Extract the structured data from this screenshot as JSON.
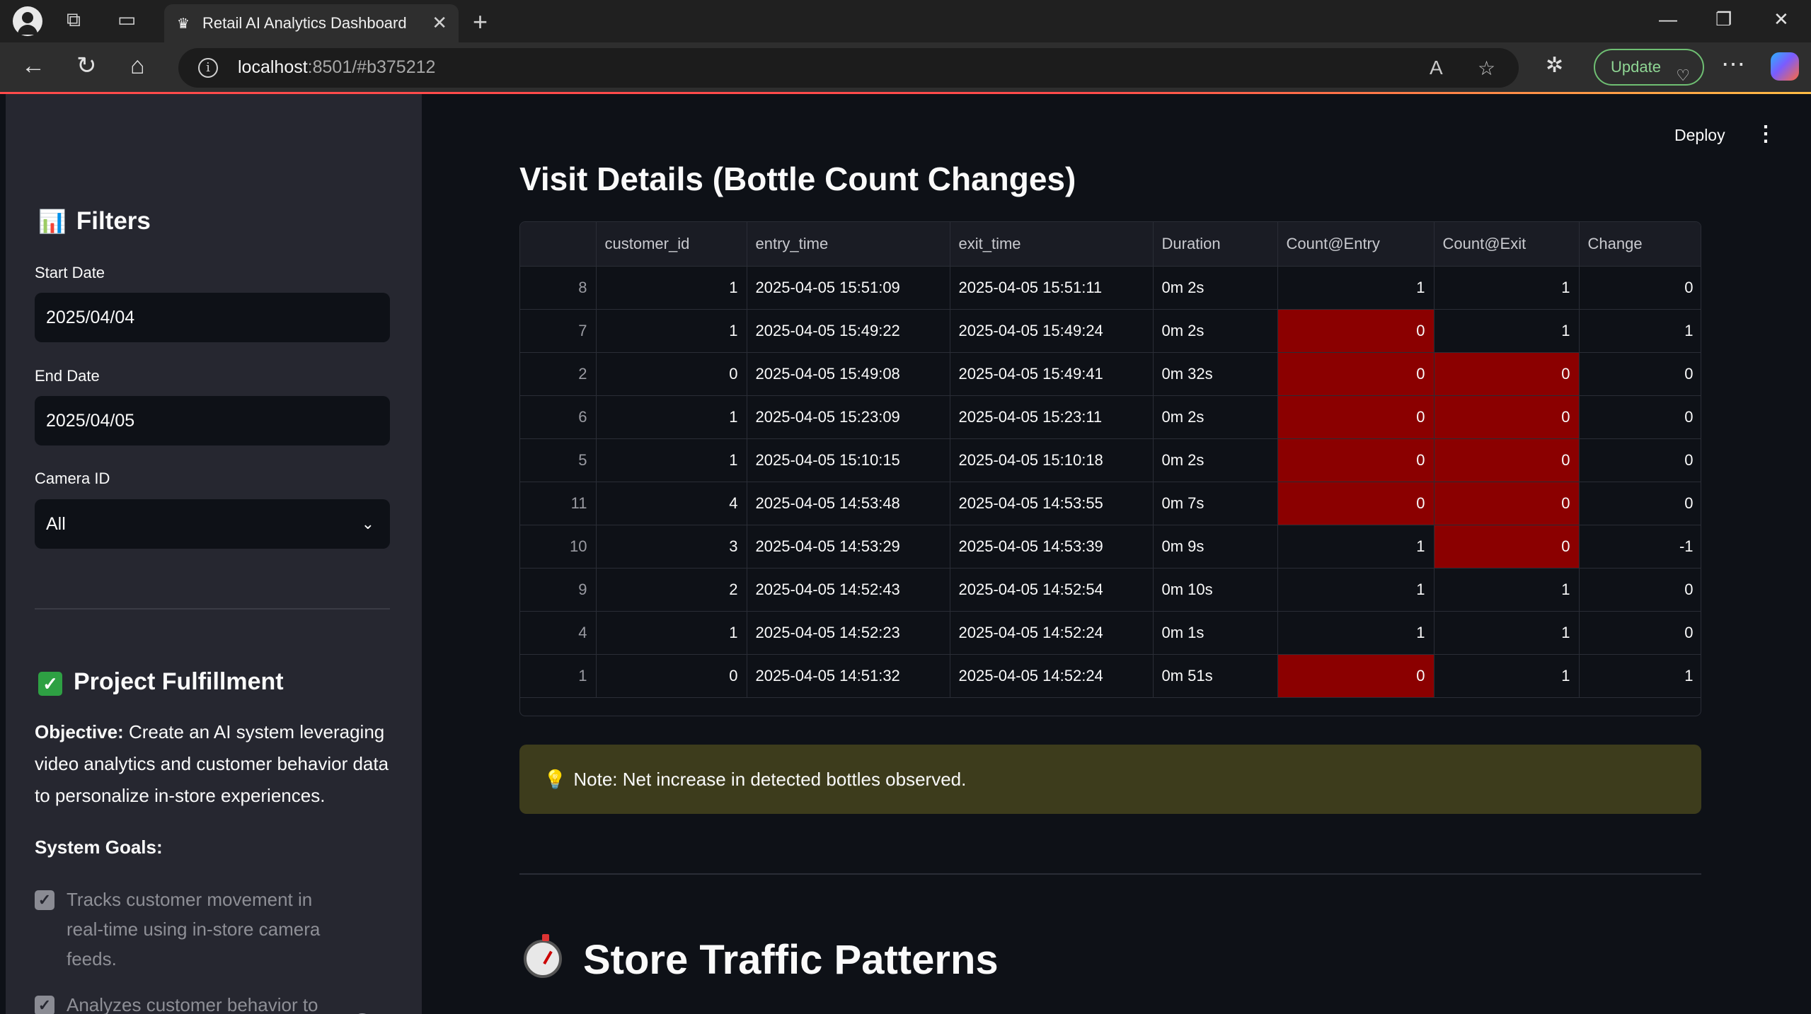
{
  "browser": {
    "tab_title": "Retail AI Analytics Dashboard",
    "url_host": "localhost",
    "url_rest": ":8501/#b375212",
    "update_label": "Update"
  },
  "header": {
    "deploy_label": "Deploy"
  },
  "sidebar": {
    "filters_title": "Filters",
    "start_date_label": "Start Date",
    "start_date_value": "2025/04/04",
    "end_date_label": "End Date",
    "end_date_value": "2025/04/05",
    "camera_label": "Camera ID",
    "camera_value": "All",
    "project_title": "Project Fulfillment",
    "objective_label": "Objective:",
    "objective_text": " Create an AI system leveraging video analytics and customer behavior data to personalize in-store experiences.",
    "goals_title": "System Goals:",
    "goal_1": "Tracks customer movement in real-time using in-store camera feeds.",
    "goal_2": "Analyzes customer behavior to"
  },
  "main": {
    "title": "Visit Details (Bottle Count Changes)",
    "note_text": "Note: Net increase in detected bottles observed.",
    "section_title": "Store Traffic Patterns"
  },
  "table": {
    "columns": [
      "",
      "customer_id",
      "entry_time",
      "exit_time",
      "Duration",
      "Count@Entry",
      "Count@Exit",
      "Change"
    ],
    "rows": [
      {
        "idx": "8",
        "customer_id": "1",
        "entry_time": "2025-04-05 15:51:09",
        "exit_time": "2025-04-05 15:51:11",
        "duration": "0m 2s",
        "count_entry": "1",
        "count_exit": "1",
        "change": "0",
        "entry_red": false,
        "exit_red": false
      },
      {
        "idx": "7",
        "customer_id": "1",
        "entry_time": "2025-04-05 15:49:22",
        "exit_time": "2025-04-05 15:49:24",
        "duration": "0m 2s",
        "count_entry": "0",
        "count_exit": "1",
        "change": "1",
        "entry_red": true,
        "exit_red": false
      },
      {
        "idx": "2",
        "customer_id": "0",
        "entry_time": "2025-04-05 15:49:08",
        "exit_time": "2025-04-05 15:49:41",
        "duration": "0m 32s",
        "count_entry": "0",
        "count_exit": "0",
        "change": "0",
        "entry_red": true,
        "exit_red": true
      },
      {
        "idx": "6",
        "customer_id": "1",
        "entry_time": "2025-04-05 15:23:09",
        "exit_time": "2025-04-05 15:23:11",
        "duration": "0m 2s",
        "count_entry": "0",
        "count_exit": "0",
        "change": "0",
        "entry_red": true,
        "exit_red": true
      },
      {
        "idx": "5",
        "customer_id": "1",
        "entry_time": "2025-04-05 15:10:15",
        "exit_time": "2025-04-05 15:10:18",
        "duration": "0m 2s",
        "count_entry": "0",
        "count_exit": "0",
        "change": "0",
        "entry_red": true,
        "exit_red": true
      },
      {
        "idx": "11",
        "customer_id": "4",
        "entry_time": "2025-04-05 14:53:48",
        "exit_time": "2025-04-05 14:53:55",
        "duration": "0m 7s",
        "count_entry": "0",
        "count_exit": "0",
        "change": "0",
        "entry_red": true,
        "exit_red": true
      },
      {
        "idx": "10",
        "customer_id": "3",
        "entry_time": "2025-04-05 14:53:29",
        "exit_time": "2025-04-05 14:53:39",
        "duration": "0m 9s",
        "count_entry": "1",
        "count_exit": "0",
        "change": "-1",
        "entry_red": false,
        "exit_red": true
      },
      {
        "idx": "9",
        "customer_id": "2",
        "entry_time": "2025-04-05 14:52:43",
        "exit_time": "2025-04-05 14:52:54",
        "duration": "0m 10s",
        "count_entry": "1",
        "count_exit": "1",
        "change": "0",
        "entry_red": false,
        "exit_red": false
      },
      {
        "idx": "4",
        "customer_id": "1",
        "entry_time": "2025-04-05 14:52:23",
        "exit_time": "2025-04-05 14:52:24",
        "duration": "0m 1s",
        "count_entry": "1",
        "count_exit": "1",
        "change": "0",
        "entry_red": false,
        "exit_red": false
      },
      {
        "idx": "1",
        "customer_id": "0",
        "entry_time": "2025-04-05 14:51:32",
        "exit_time": "2025-04-05 14:52:24",
        "duration": "0m 51s",
        "count_entry": "0",
        "count_exit": "1",
        "change": "1",
        "entry_red": true,
        "exit_red": false
      }
    ]
  },
  "colors": {
    "highlight_red": "#8b0000",
    "note_bg": "#3d3c1c",
    "sidebar_bg": "#262730",
    "app_bg": "#0e1117"
  }
}
